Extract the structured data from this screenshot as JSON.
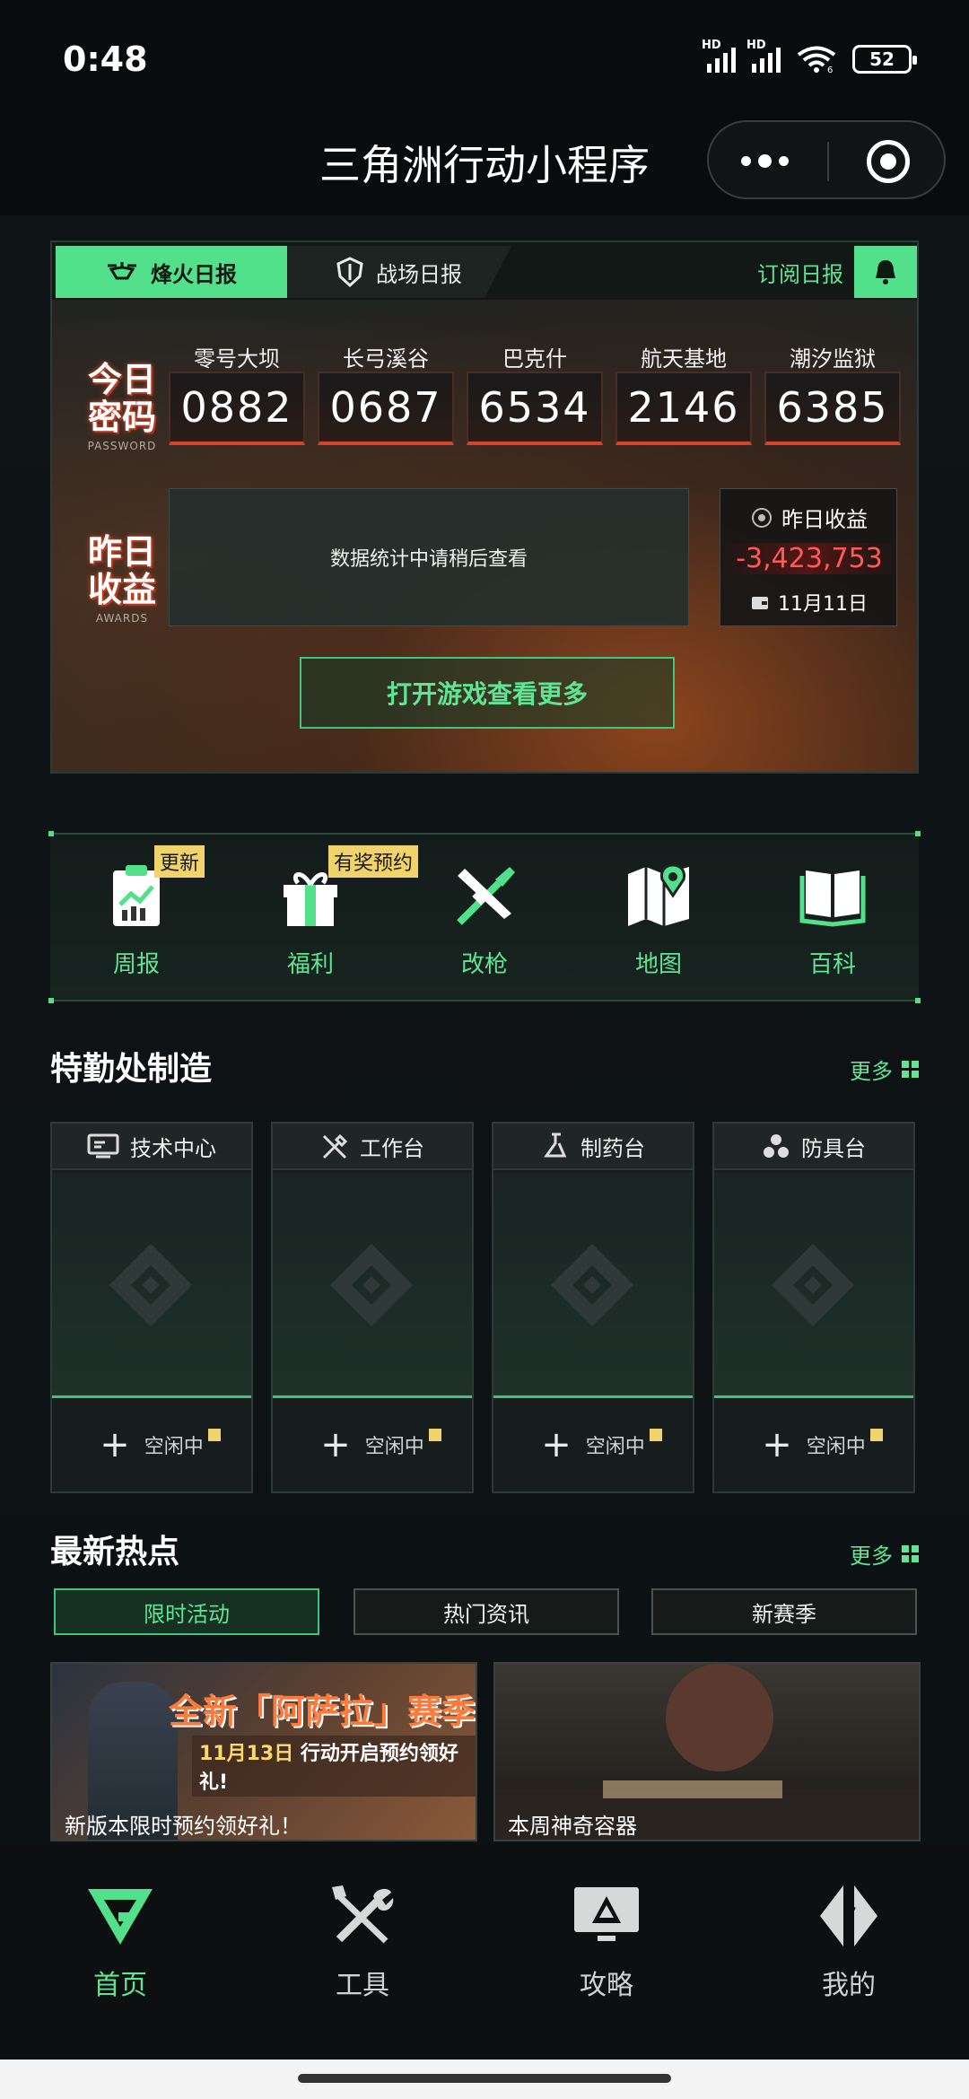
{
  "status_bar": {
    "time": "0:48",
    "battery": "52",
    "signal1": "HD",
    "signal2": "HD",
    "wifi_sub": "6"
  },
  "title_bar": {
    "title": "三角洲行动小程序"
  },
  "report": {
    "tabs": [
      {
        "label": "烽火日报",
        "active": true
      },
      {
        "label": "战场日报",
        "active": false
      }
    ],
    "subscribe_label": "订阅日报",
    "password_label": {
      "main": "今日\n密码",
      "sub": "PASSWORD"
    },
    "awards_label": {
      "main": "昨日\n收益",
      "sub": "AWARDS"
    },
    "codes": [
      {
        "map": "零号大坝",
        "code": "0882"
      },
      {
        "map": "长弓溪谷",
        "code": "0687"
      },
      {
        "map": "巴克什",
        "code": "6534"
      },
      {
        "map": "航天基地",
        "code": "2146"
      },
      {
        "map": "潮汐监狱",
        "code": "6385"
      }
    ],
    "stats_message": "数据统计中请稍后查看",
    "income": {
      "label": "昨日收益",
      "value": "-3,423,753",
      "date": "11月11日"
    },
    "open_game_button": "打开游戏查看更多"
  },
  "quick_menu": [
    {
      "label": "周报",
      "badge": "更新",
      "icon": "report-clipboard-icon"
    },
    {
      "label": "福利",
      "badge": "有奖预约",
      "icon": "gift-icon"
    },
    {
      "label": "改枪",
      "badge": "",
      "icon": "gun-wrench-icon"
    },
    {
      "label": "地图",
      "badge": "",
      "icon": "map-pin-icon"
    },
    {
      "label": "百科",
      "badge": "",
      "icon": "book-icon"
    }
  ],
  "crafting": {
    "title": "特勤处制造",
    "more": "更多",
    "stations": [
      {
        "name": "技术中心",
        "status": "空闲中",
        "icon": "computer-icon"
      },
      {
        "name": "工作台",
        "status": "空闲中",
        "icon": "tools-icon"
      },
      {
        "name": "制药台",
        "status": "空闲中",
        "icon": "flask-icon"
      },
      {
        "name": "防具台",
        "status": "空闲中",
        "icon": "armor-icon"
      }
    ]
  },
  "news": {
    "title": "最新热点",
    "more": "更多",
    "tabs": [
      {
        "label": "限时活动",
        "active": true
      },
      {
        "label": "热门资讯",
        "active": false
      },
      {
        "label": "新赛季",
        "active": false
      }
    ],
    "cards": [
      {
        "caption": "新版本限时预约领好礼！",
        "banner_title": "全新「阿萨拉」赛季",
        "banner_date": "11月13日",
        "banner_rest": " 行动开启预约领好礼!"
      },
      {
        "caption": "本周神奇容器"
      }
    ]
  },
  "tab_bar": [
    {
      "label": "首页",
      "active": true,
      "icon": "home-g-icon"
    },
    {
      "label": "工具",
      "active": false,
      "icon": "tools-icon"
    },
    {
      "label": "攻略",
      "active": false,
      "icon": "guide-monitor-icon"
    },
    {
      "label": "我的",
      "active": false,
      "icon": "profile-icon"
    }
  ],
  "colors": {
    "accent": "#52e08a",
    "accent_text": "#5fe594",
    "badge": "#f0d36a",
    "negative": "#ff5a55",
    "code_underline": "#d5432a"
  }
}
